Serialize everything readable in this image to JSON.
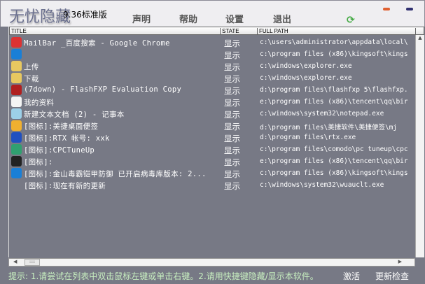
{
  "app": {
    "title": "无忧隐藏",
    "version": "9.36标准版"
  },
  "menu": [
    "声明",
    "帮助",
    "设置",
    "退出"
  ],
  "columns": [
    "TITLE",
    "STATE",
    "FULL PATH"
  ],
  "rows": [
    {
      "icon": "chrome-icon",
      "color": "#d33",
      "title": "MailBar _百度搜索 - Google Chrome",
      "state": "显示",
      "path": "c:\\users\\administrator\\appdata\\local\\"
    },
    {
      "icon": "kingsoft-icon",
      "color": "#1a7fd6",
      "title": "",
      "state": "显示",
      "path": "c:\\program files (x86)\\kingsoft\\kings"
    },
    {
      "icon": "folder-icon",
      "color": "#e8c860",
      "title": "上传",
      "state": "显示",
      "path": "c:\\windows\\explorer.exe"
    },
    {
      "icon": "folder-icon",
      "color": "#e8c860",
      "title": "下载",
      "state": "显示",
      "path": "c:\\windows\\explorer.exe"
    },
    {
      "icon": "flashfxp-icon",
      "color": "#b02020",
      "title": "(7down) - FlashFXP Evaluation Copy",
      "state": "显示",
      "path": "d:\\program files\\flashfxp 5\\flashfxp."
    },
    {
      "icon": "qq-icon",
      "color": "#f4f4f4",
      "title": "我的资料",
      "state": "显示",
      "path": "e:\\program files (x86)\\tencent\\qq\\bir"
    },
    {
      "icon": "notepad-icon",
      "color": "#9cd0e8",
      "title": "新建文本文档 (2) - 记事本",
      "state": "显示",
      "path": "c:\\windows\\system32\\notepad.exe"
    },
    {
      "icon": "sticky-note-icon",
      "color": "#f0b030",
      "title": "[图标]:美捷桌面便签",
      "state": "显示",
      "path": "d:\\program files\\美捷软件\\美捷便签\\mj"
    },
    {
      "icon": "rtx-icon",
      "color": "#2050c0",
      "title": "[图标]:RTX 帐号: xxk",
      "state": "显示",
      "path": "d:\\program files\\rtx.exe"
    },
    {
      "icon": "cpctuneup-icon",
      "color": "#30a070",
      "title": "[图标]:CPCTuneUp",
      "state": "显示",
      "path": "c:\\program files\\comodo\\pc tuneup\\cpc"
    },
    {
      "icon": "qq-penguin-icon",
      "color": "#222",
      "title": "[图标]:",
      "state": "显示",
      "path": "e:\\program files (x86)\\tencent\\qq\\bir"
    },
    {
      "icon": "kingsoft-icon",
      "color": "#1a7fd6",
      "title": "[图标]:金山毒霸铠甲防御 已开启病毒库版本: 2...",
      "state": "显示",
      "path": "c:\\program files (x86)\\kingsoft\\kings"
    },
    {
      "icon": "",
      "color": "",
      "title": "[图标]:现在有新的更新",
      "state": "显示",
      "path": "c:\\windows\\system32\\wuauclt.exe"
    }
  ],
  "footer": {
    "hint": "提示: 1.请尝试在列表中双击鼠标左键或单击右键。2.请用快捷键隐藏/显示本软件。",
    "activate": "激活",
    "update": "更新检查"
  }
}
